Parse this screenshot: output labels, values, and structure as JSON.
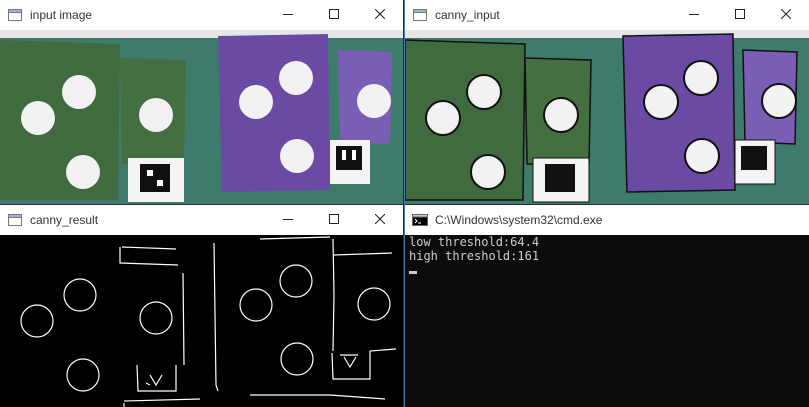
{
  "windows": {
    "input_image": {
      "title": "input image"
    },
    "canny_input": {
      "title": "canny_input"
    },
    "canny_result": {
      "title": "canny_result"
    },
    "cmd": {
      "title": "C:\\Windows\\system32\\cmd.exe",
      "lines": [
        "low threshold:64.4",
        "high threshold:161"
      ]
    }
  },
  "icons": {
    "window_icon": "app-window-icon",
    "cmd_icon": "console-icon",
    "minimize": "minimize-icon",
    "maximize": "maximize-icon",
    "close": "close-icon"
  },
  "colors": {
    "table": "#3f7b6c",
    "green_board": "#3f6b3e",
    "purple_board": "#6a4aa3",
    "ball": "#f2f2f2",
    "console_bg": "#0c0c0c",
    "console_text": "#cccccc"
  }
}
